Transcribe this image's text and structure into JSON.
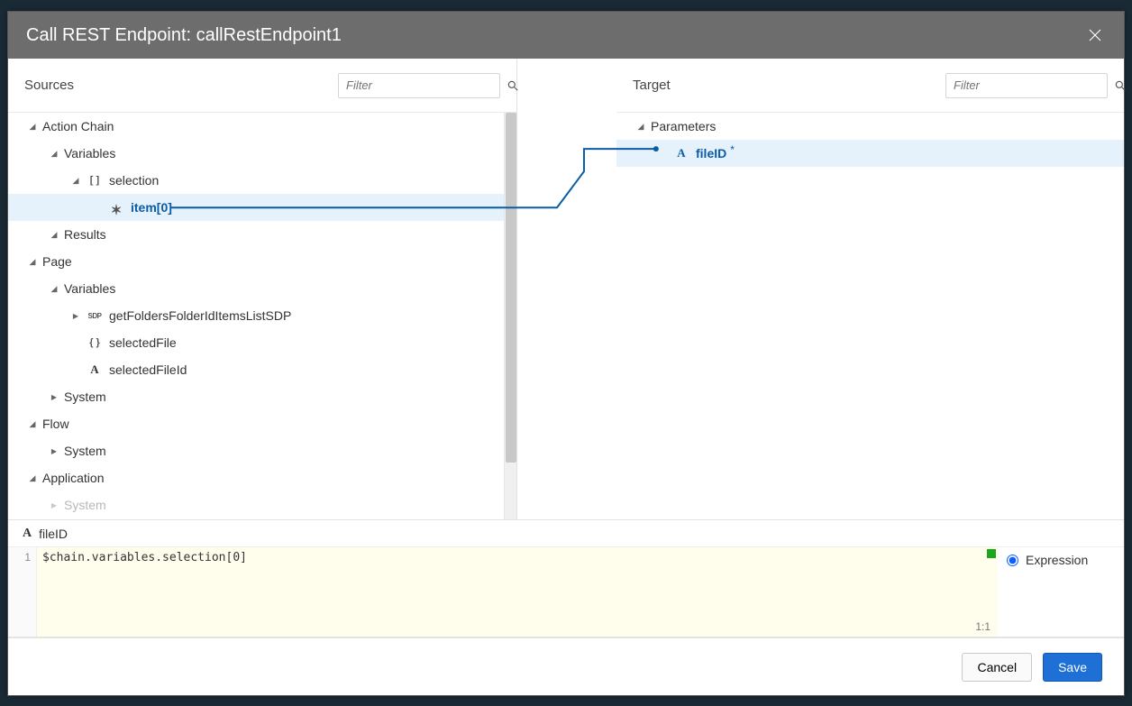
{
  "title": "Call REST Endpoint: callRestEndpoint1",
  "sources": {
    "header": "Sources",
    "filter_placeholder": "Filter",
    "tree": {
      "actionChain": {
        "label": "Action Chain",
        "variables": {
          "label": "Variables",
          "selection": {
            "label": "selection",
            "item0": "item[0]"
          }
        },
        "results": {
          "label": "Results"
        }
      },
      "page": {
        "label": "Page",
        "variables": {
          "label": "Variables",
          "sdp": "getFoldersFolderIdItemsListSDP",
          "selectedFile": "selectedFile",
          "selectedFileId": "selectedFileId"
        },
        "system": "System"
      },
      "flow": {
        "label": "Flow",
        "system": "System"
      },
      "application": {
        "label": "Application",
        "system": "System"
      }
    }
  },
  "target": {
    "header": "Target",
    "filter_placeholder": "Filter",
    "tree": {
      "parameters": {
        "label": "Parameters",
        "fileID": "fileID"
      }
    }
  },
  "editor": {
    "field_label": "fileID",
    "line_number": "1",
    "code": "$chain.variables.selection[0]",
    "cursor": "1:1",
    "mode_label": "Expression"
  },
  "footer": {
    "cancel": "Cancel",
    "save": "Save"
  }
}
